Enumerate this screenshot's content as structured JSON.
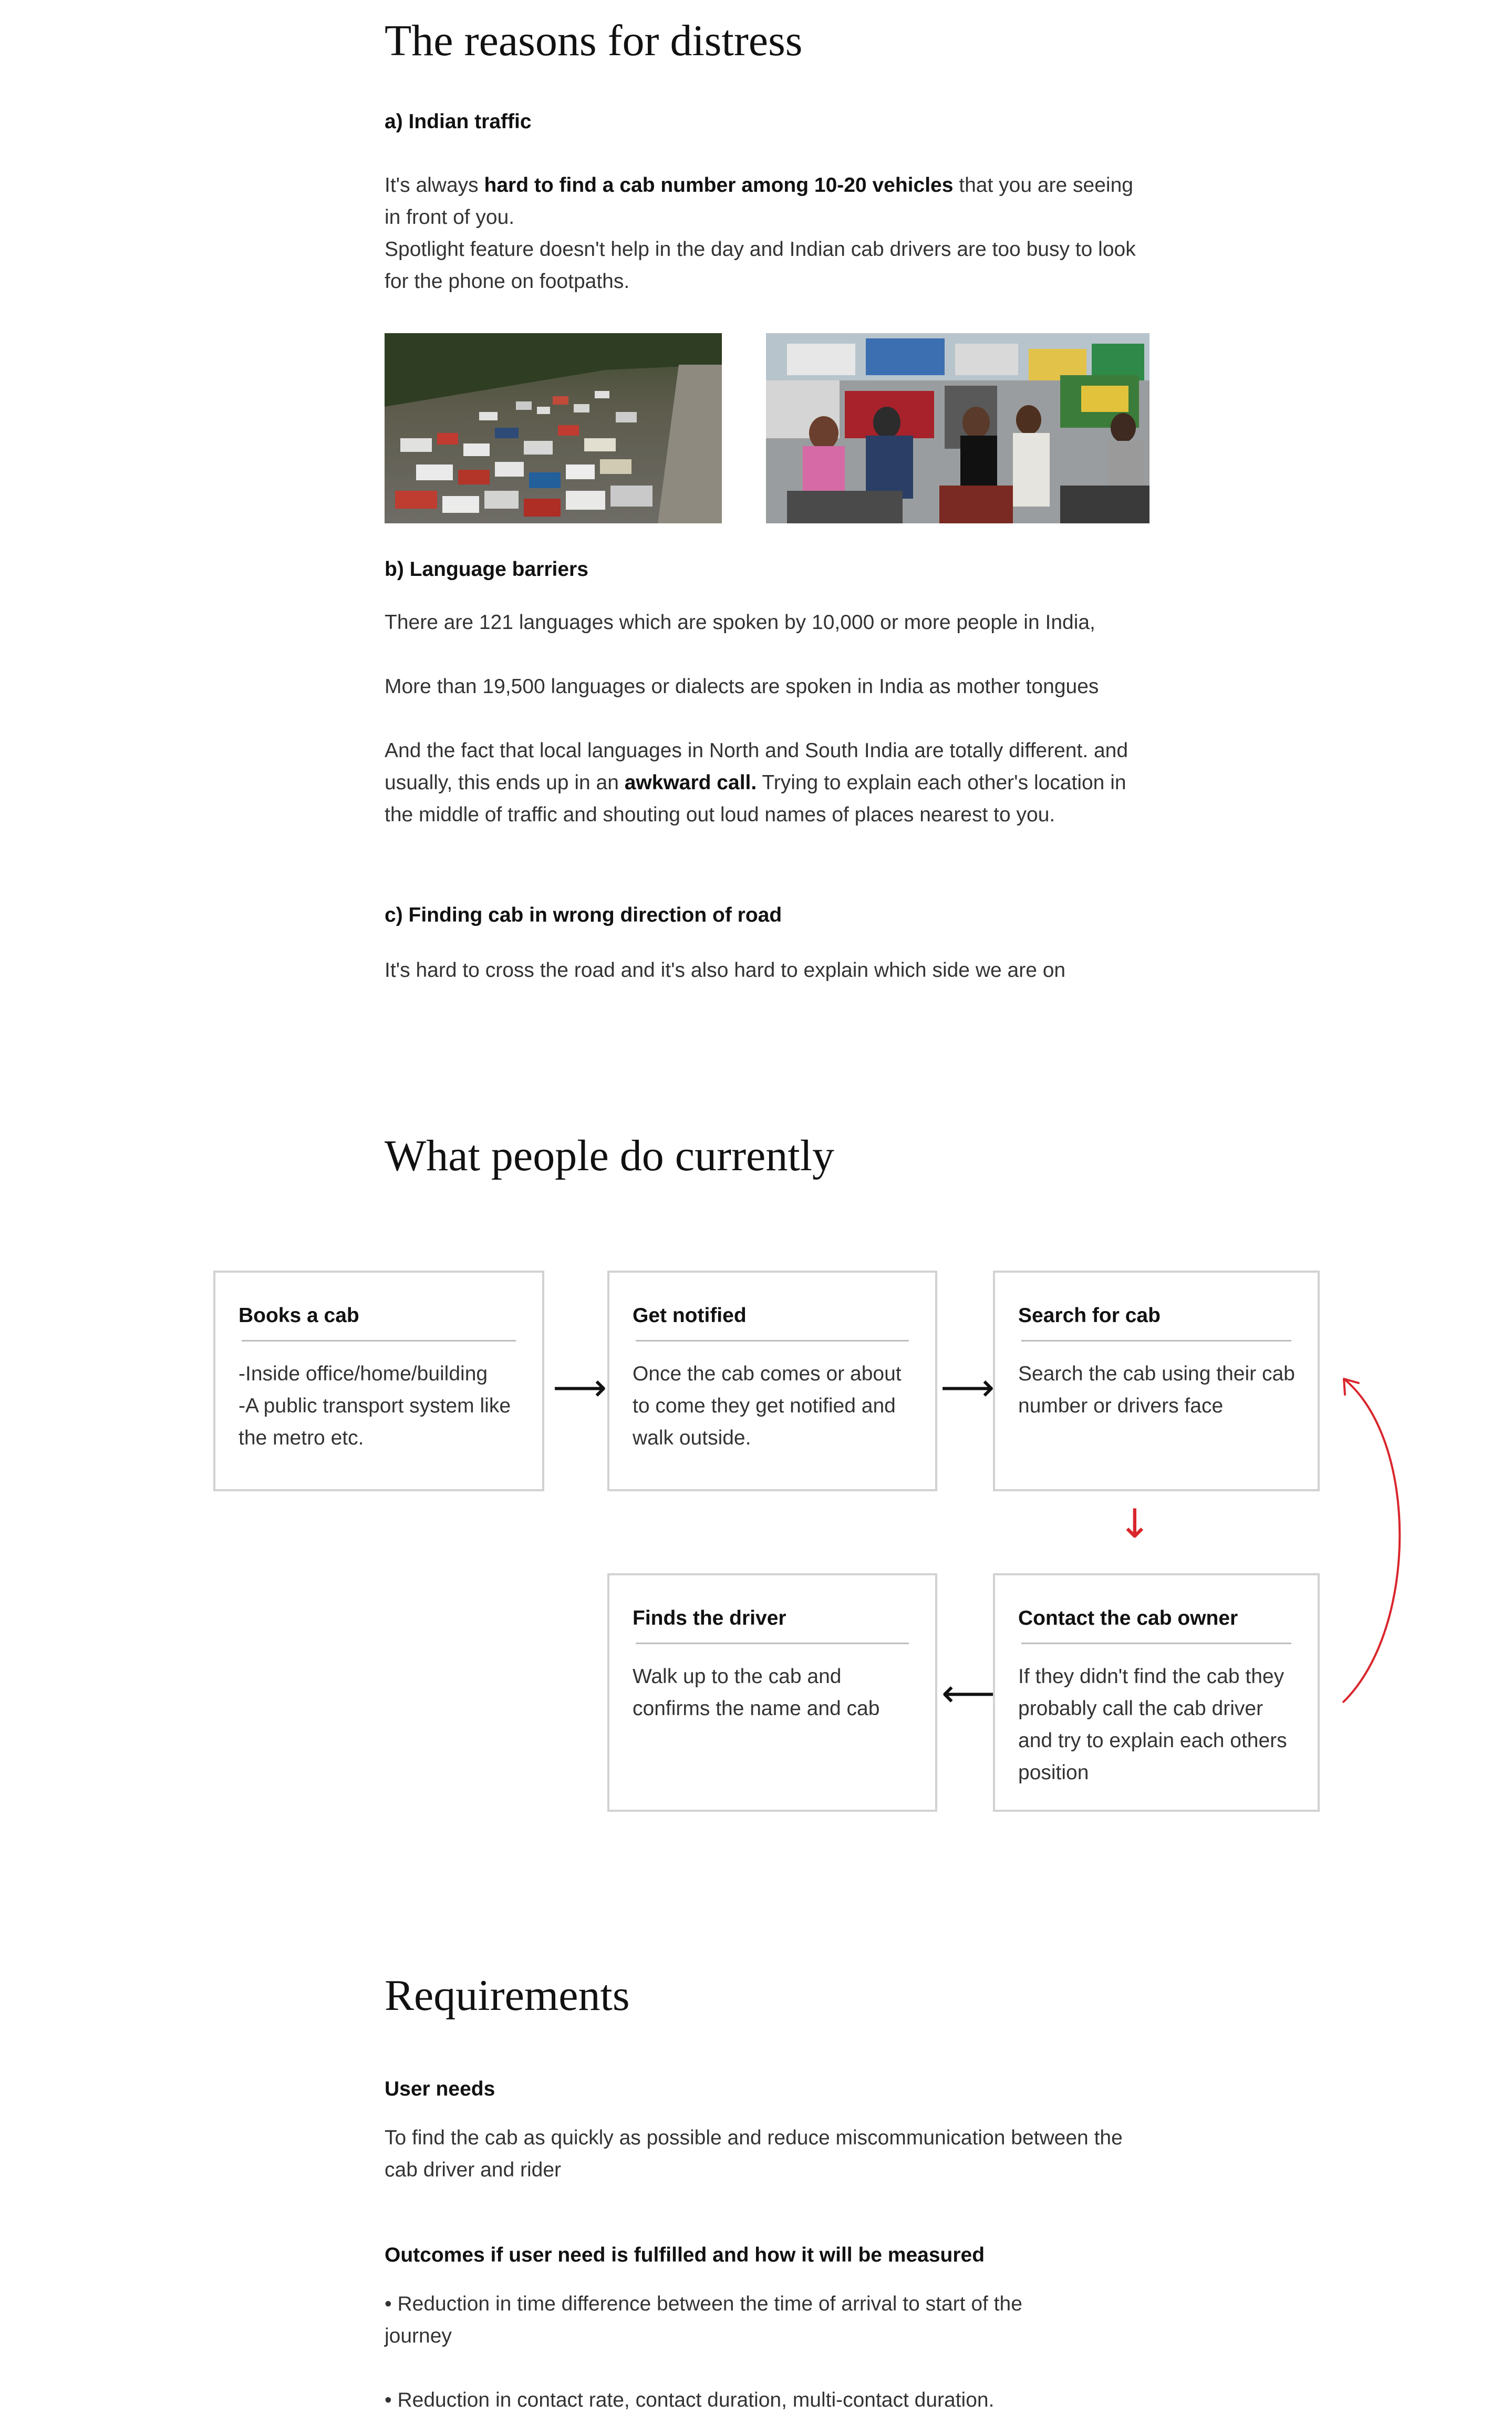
{
  "section1": {
    "title": "The reasons for distress",
    "a_title": "a) Indian traffic",
    "a_p1_pre": "It's always ",
    "a_p1_bold": "hard to find a cab number among 10-20 vehicles",
    "a_p1_post": " that you are seeing in front of you.",
    "a_p2": "Spotlight feature doesn't help in the day and Indian cab drivers are too busy to look for the phone on footpaths.",
    "b_title": "b) Language barriers",
    "b_p1": "There are 121 languages which are spoken by 10,000 or more people in India,",
    "b_p2": "More than 19,500 languages or dialects are spoken in India as mother tongues",
    "b_p3_pre": "And the fact that local languages in North and South India are totally different. and usually, this ends up in an ",
    "b_p3_bold": "awkward call.",
    "b_p3_post": " Trying to explain each other's location in the middle of traffic and shouting out loud names of places nearest to you.",
    "c_title": "c) Finding cab in wrong direction of road",
    "c_p1": "It's hard to cross the road and it's also hard to explain which side we are on"
  },
  "section2": {
    "title": "What people do currently",
    "steps": [
      {
        "title": "Books a cab",
        "body": "-Inside office/home/building\n-A public transport system like the metro etc."
      },
      {
        "title": "Get notified",
        "body": "Once the cab comes or about to come they get notified and walk outside."
      },
      {
        "title": "Search for cab",
        "body": "Search the cab using their cab number or drivers face"
      },
      {
        "title": "Contact the cab owner",
        "body": "If they didn't find the cab they probably call the cab driver and try to explain each others position"
      },
      {
        "title": "Finds the driver",
        "body": "Walk up to the cab and confirms the name and cab"
      }
    ],
    "arrows": {
      "right": "⟶",
      "left": "⟵",
      "down": "↓"
    },
    "accent_color": "#d9262c"
  },
  "section3": {
    "title": "Requirements",
    "needs_title": "User needs",
    "needs_body": "To find the cab as quickly as possible and reduce miscommunication between the cab driver and rider",
    "outcomes_title": "Outcomes if user need is fulfilled and how it will be measured",
    "outcomes": [
      "• Reduction in time difference between the time of arrival to start of the journey",
      "• Reduction in contact rate, contact duration, multi-contact duration."
    ]
  }
}
